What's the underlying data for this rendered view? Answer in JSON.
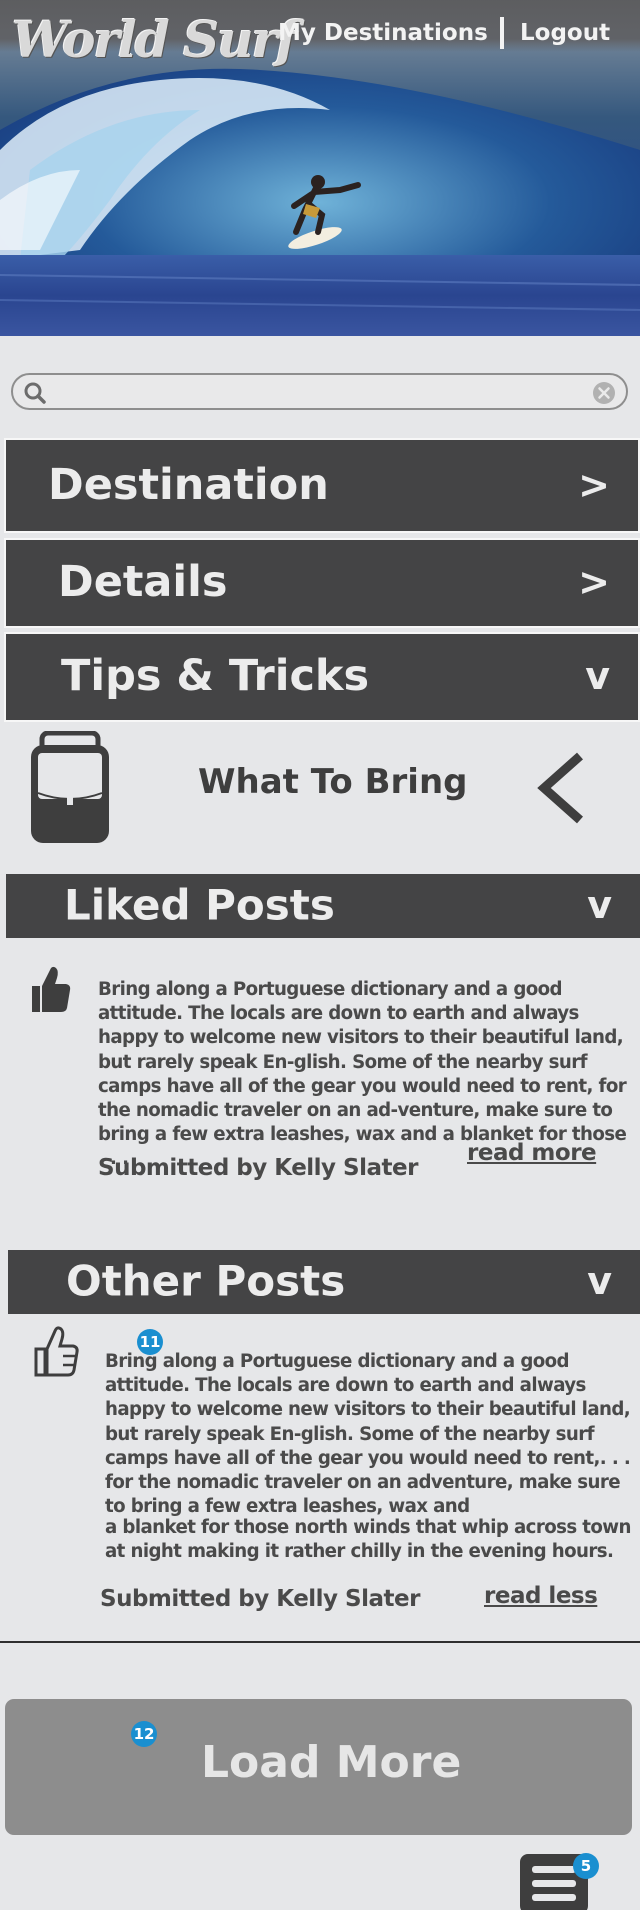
{
  "header": {
    "logo_text": "World Surf",
    "nav": {
      "my_destinations": "My Destinations",
      "separator": "|",
      "logout": "Logout"
    }
  },
  "search": {
    "value": "",
    "placeholder": "",
    "search_icon": "search-icon",
    "clear_icon": "clear-icon"
  },
  "accordion": {
    "destination": {
      "label": "Destination",
      "chevron": ">"
    },
    "details": {
      "label": "Details",
      "chevron": ">"
    },
    "tips": {
      "label": "Tips & Tricks",
      "chevron": "v"
    }
  },
  "tips_item": {
    "title": "What To Bring",
    "icon": "backpack-icon",
    "back_icon": "chevron-left-icon"
  },
  "liked_posts": {
    "label": "Liked Posts",
    "chevron": "v",
    "post": {
      "text": "Bring along a Portuguese dictionary and a good attitude. The locals are down to earth and always happy to welcome new visitors to their beautiful land, but rarely speak En-glish. Some of the nearby surf camps have all of the gear you would need to rent, for the nomadic traveler on an ad-venture, make sure to bring a few extra leashes, wax and a blanket for those . . .",
      "submitted": "Submitted by Kelly Slater",
      "read_link": "read more"
    }
  },
  "other_posts": {
    "label": "Other Posts",
    "chevron": "v",
    "badge": "11",
    "post": {
      "text_a": "Bring along a Portuguese dictionary and a good attitude. The locals are down to earth and always happy to welcome new visitors to their beautiful land, but rarely speak En-glish. Some of the nearby surf camps have all of the gear you would need to rent,. . . for the nomadic traveler on an adventure, make sure to bring a few extra leashes, wax and",
      "text_b": "a blanket for those north winds that  whip across town at night making it rather chilly in the evening hours.",
      "submitted": "Submitted by Kelly Slater",
      "read_link": "read less"
    }
  },
  "load_more": {
    "label": "Load More",
    "badge": "12"
  },
  "menu": {
    "icon": "menu-icon",
    "badge": "5"
  }
}
